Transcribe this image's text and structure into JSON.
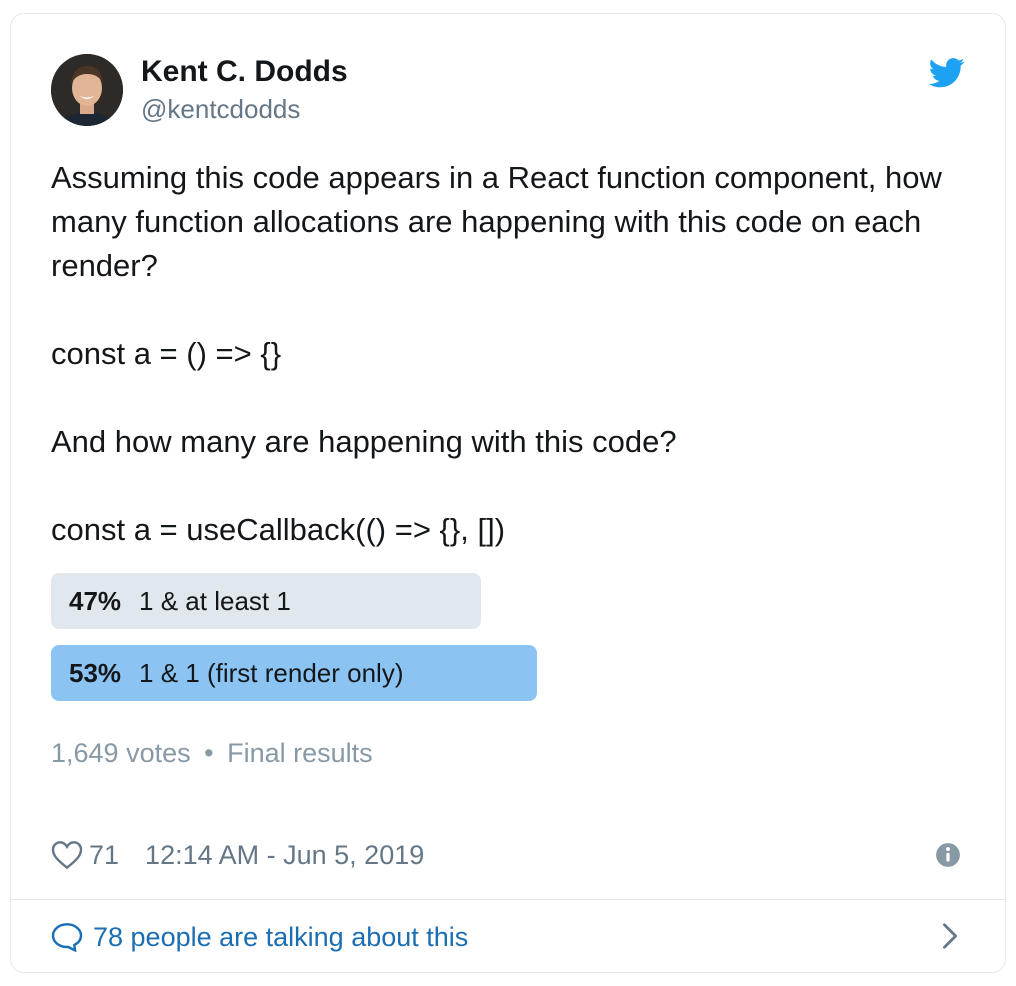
{
  "author": {
    "name": "Kent C. Dodds",
    "handle": "@kentcdodds"
  },
  "tweet": {
    "lines": [
      "Assuming this code appears in a React function component, how many function allocations are happening with this code on each render?",
      "const a = () => {}",
      "And how many are happening with this code?",
      "const a = useCallback(() => {}, [])"
    ]
  },
  "poll": {
    "options": [
      {
        "percent": "47%",
        "label": "1 & at least 1",
        "share": 47
      },
      {
        "percent": "53%",
        "label": "1 & 1 (first render only)",
        "share": 53
      }
    ],
    "votes": "1,649 votes",
    "separator": "•",
    "status": "Final results"
  },
  "footer": {
    "likes": "71",
    "timestamp": "12:14 AM - Jun 5, 2019"
  },
  "conversation": {
    "label": "78 people are talking about this"
  },
  "icons": {
    "logo": "twitter-bird-icon",
    "like": "heart-icon",
    "info": "info-icon",
    "reply": "speech-bubble-icon",
    "more": "chevron-right-icon"
  },
  "colors": {
    "brand": "#1da1f2",
    "poll_winner": "#8bc4f3",
    "poll_other": "#e1e8ed",
    "link": "#1b6eb2",
    "muted": "#8899a6"
  }
}
